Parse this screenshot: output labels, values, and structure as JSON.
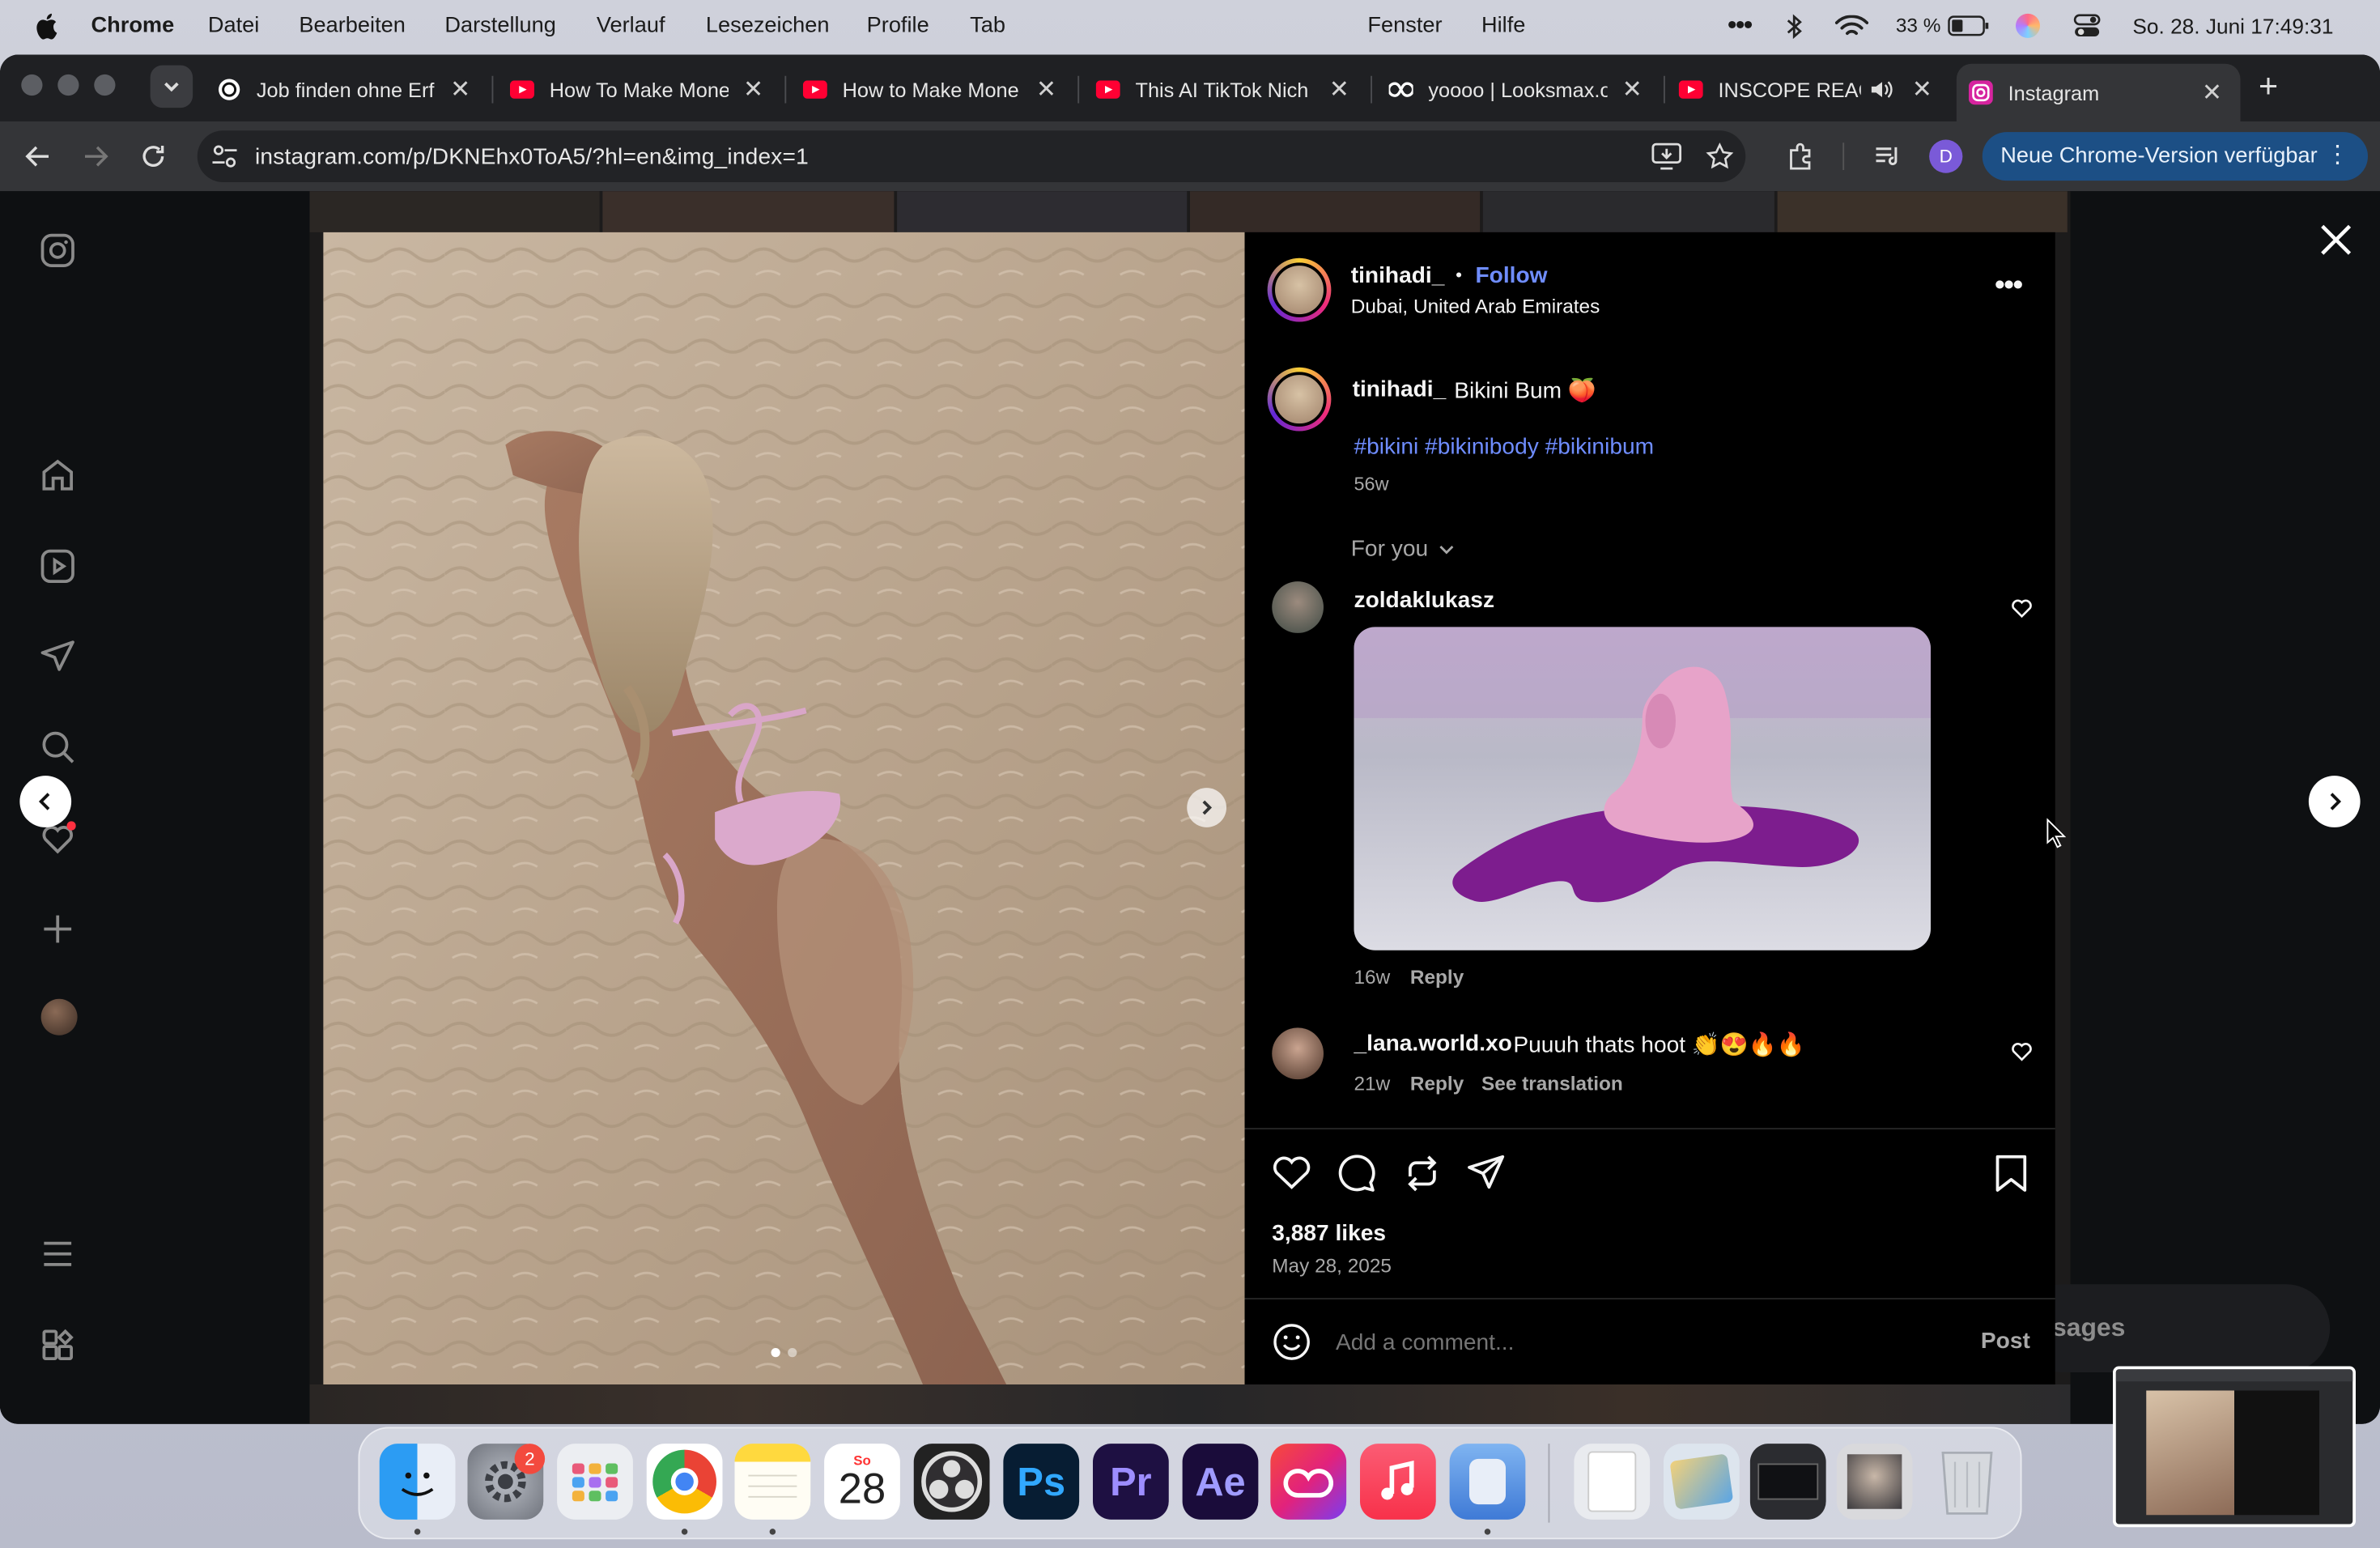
{
  "menubar": {
    "app": "Chrome",
    "items": [
      "Datei",
      "Bearbeiten",
      "Darstellung",
      "Verlauf",
      "Lesezeichen",
      "Profile",
      "Tab"
    ],
    "right_items": [
      "Fenster",
      "Hilfe"
    ],
    "battery": "33 %",
    "datetime": "So. 28. Juni  17:49:31"
  },
  "tabs": [
    {
      "title": "Job finden ohne Erf",
      "icon": "chatgpt-icon"
    },
    {
      "title": "How To Make Mone",
      "icon": "youtube-icon"
    },
    {
      "title": "How to Make Mone",
      "icon": "youtube-icon"
    },
    {
      "title": "This AI TikTok Nich",
      "icon": "youtube-icon"
    },
    {
      "title": "yoooo | Looksmax.o",
      "icon": "looksmax-icon"
    },
    {
      "title": "INSCOPE REAC",
      "icon": "youtube-icon",
      "audio": true
    },
    {
      "title": "Instagram",
      "icon": "instagram-icon",
      "active": true
    }
  ],
  "toolbar": {
    "url": "instagram.com/p/DKNEhx0ToA5/?hl=en&img_index=1",
    "profile_initial": "D",
    "update_label": "Neue Chrome-Version verfügbar"
  },
  "post": {
    "username": "tinihadi_",
    "follow_label": "Follow",
    "dot": "•",
    "location": "Dubai, United Arab Emirates",
    "caption_user": "tinihadi_",
    "caption_text": "Bikini Bum 🍑",
    "hashtags": "#bikini #bikinibody #bikinibum",
    "caption_age": "56w",
    "sort_label": "For you",
    "likes": "3,887 likes",
    "date": "May 28, 2025",
    "comment_placeholder": "Add a comment...",
    "post_button": "Post"
  },
  "comments": [
    {
      "user": "zoldaklukasz",
      "text": "",
      "age": "16w",
      "reply": "Reply",
      "has_image": true
    },
    {
      "user": "_lana.world.xo",
      "text": "Puuuh thats hoot 👏😍🔥🔥",
      "age": "21w",
      "reply": "Reply",
      "translate": "See translation"
    }
  ],
  "messages_partial": "sages",
  "dock": {
    "calendar_month": "So",
    "calendar_day": "28",
    "settings_badge": "2",
    "apps": [
      "Finder",
      "System Settings",
      "Launchpad",
      "Chrome",
      "Notes",
      "Calendar",
      "OBS",
      "Ps",
      "Pr",
      "Ae",
      "Creative Cloud",
      "Music",
      "Unknown",
      "HTTP File",
      "Preview",
      "Screens",
      "Photo",
      "Trash"
    ]
  },
  "colors": {
    "link_blue": "#6f8dff",
    "update_button": "#1c4f85",
    "panel_bg": "#000000"
  }
}
